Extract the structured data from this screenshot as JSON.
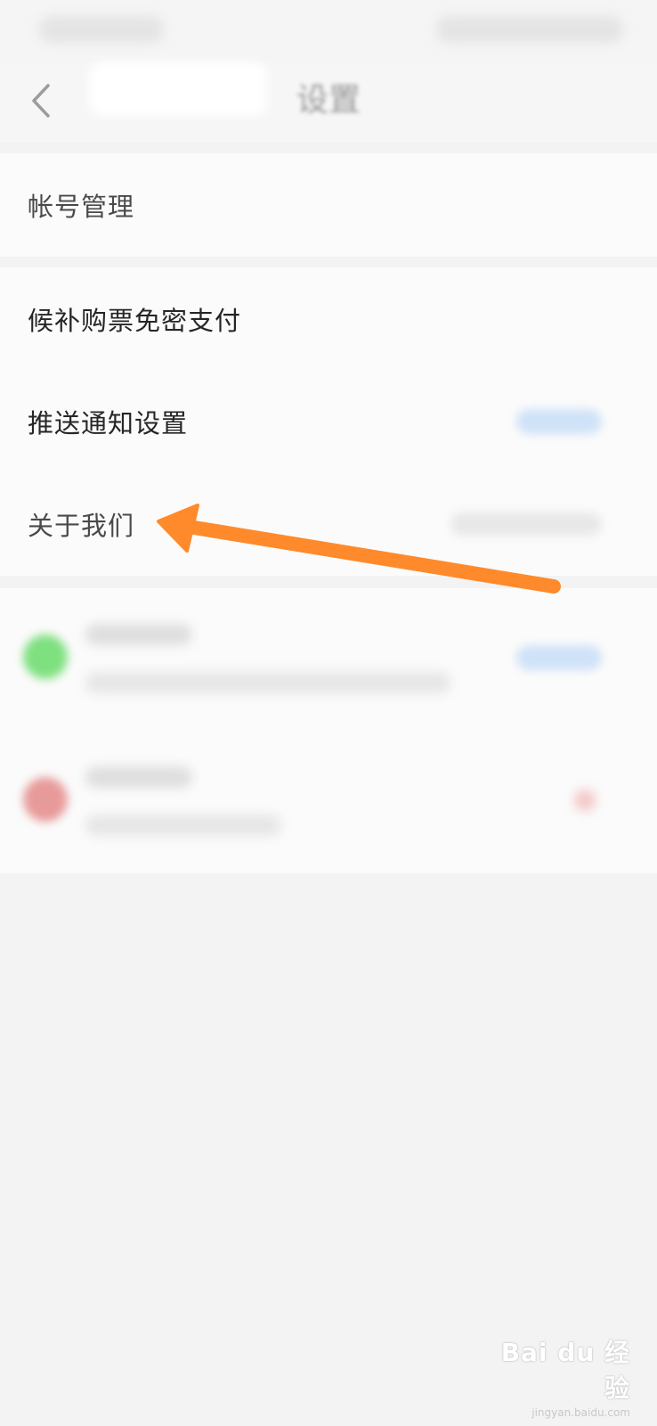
{
  "nav": {
    "title": "设置",
    "back_icon": "chevron-left-icon"
  },
  "settings": {
    "group1": [
      {
        "label": "帐号管理"
      }
    ],
    "group2": [
      {
        "label": "候补购票免密支付"
      },
      {
        "label": "推送通知设置"
      },
      {
        "label": "关于我们"
      }
    ]
  },
  "annotation": {
    "arrow_color": "#ff8a2b"
  },
  "watermark": {
    "main": "Bai du 经验",
    "sub": "jingyan.baidu.com"
  },
  "colors": {
    "background": "#f3f3f3",
    "row_background": "#fbfbfb",
    "accent_pill": "#cfe2f7",
    "wechat_green": "#7fe07f",
    "red_badge": "#e79a9a"
  }
}
